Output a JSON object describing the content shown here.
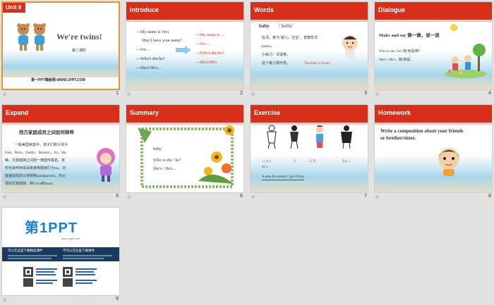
{
  "slides": [
    {
      "number": "1",
      "title": "Unit 8",
      "heading": "We're twins!",
      "sub": "第二课时",
      "footer": "第一PPT模板网-WWW.1PPT.COM"
    },
    {
      "number": "2",
      "title": "Introduce",
      "left_lines": [
        "---My name is Vivi.",
        "May I have your name?",
        "---I'm  ...",
        "---Who's she/he?",
        "---She's/He's..."
      ],
      "right_lines": [
        "---My name is ...",
        "---I'm  ...",
        "---Who's she/he?",
        "---She's/He's"
      ]
    },
    {
      "number": "3",
      "title": "Words",
      "word": "baby",
      "phonetic": "/ beibi/",
      "lines": [
        "名词，意为\"婴儿；宝宝\"。复数形式",
        "babies。",
        "小练习：汉译英。",
        "这个婴儿很可爱。"
      ],
      "answer": "The baby is lovely."
    },
    {
      "number": "4",
      "title": "Dialogue",
      "prompt": "Make and say  做一做，说一说",
      "lines": [
        "Who is she / he? 她/他是谁？",
        "She's / He's... 她/他是..."
      ]
    },
    {
      "number": "5",
      "title": "Expand",
      "heading": "西方家庭成员之间如何称呼",
      "lines": [
        "一般美国家庭中，孩子们称父母为",
        "Dad，Mom，Daddy，Mommy，Pa，Ma",
        "等。兄弟姐妹之间则一律直呼其名。有",
        "时也会听到哥哥弟弟称姐妹们为Sis。对",
        "爸爸妈妈的父母统称grandparents，对父",
        "母的兄弟姐妹，称Uncle和Aunt。"
      ]
    },
    {
      "number": "6",
      "title": "Summary",
      "lines": [
        "baby",
        "Who is  she / he?",
        "She's / He's..."
      ]
    },
    {
      "number": "7",
      "title": "Exercise",
      "answers": [
        "1.(  A  )",
        "C",
        "2.(  D",
        "B).(   )",
        "4.(  )"
      ],
      "options": "A.man    B.woman  C.girl   D.boy"
    },
    {
      "number": "8",
      "title": "Homework",
      "lines": [
        "Write a composition about your friends",
        "or brother/sister."
      ]
    },
    {
      "number": "9",
      "logo": "第1PPT",
      "logo_sub": "www.1ppt.com",
      "col1_title": "可以在这里下载精品课件",
      "col2_title": "不可以在这里下载课件"
    }
  ],
  "colors": {
    "header_red": "#d82f1b",
    "selection": "#e0982f",
    "logo_blue": "#1a7fd1",
    "banner_dark": "#173a5e"
  }
}
